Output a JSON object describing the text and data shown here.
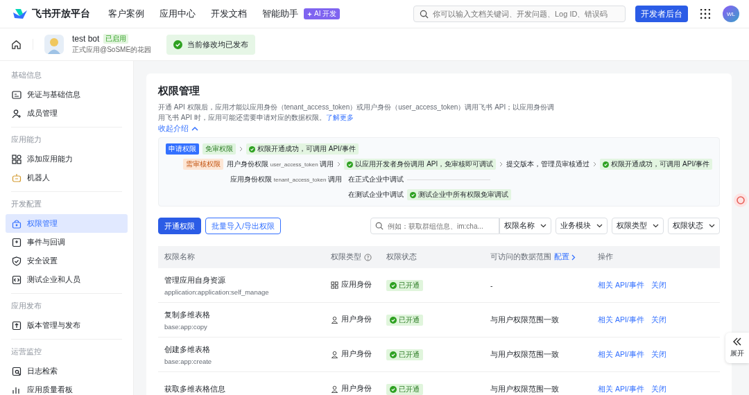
{
  "header": {
    "brand": "飞书开放平台",
    "nav": [
      {
        "label": "客户案例"
      },
      {
        "label": "应用中心"
      },
      {
        "label": "开发文档"
      },
      {
        "label": "智能助手",
        "badge": "AI 开发"
      }
    ],
    "search": {
      "placeholder": "你可以输入文档关键词、开发问题、Log ID、错误码"
    },
    "console_button": "开发者后台",
    "user_initials": "WL"
  },
  "app_bar": {
    "app_name": "test bot",
    "app_status": "已启用",
    "app_subtitle": "正式应用@SoSME的花园",
    "notice": "当前修改均已发布"
  },
  "sidebar": {
    "groups": [
      {
        "title": "基础信息",
        "items": [
          {
            "label": "凭证与基础信息",
            "selected": false
          },
          {
            "label": "成员管理",
            "selected": false
          }
        ]
      },
      {
        "title": "应用能力",
        "items": [
          {
            "label": "添加应用能力",
            "selected": false
          },
          {
            "label": "机器人",
            "selected": false
          }
        ]
      },
      {
        "title": "开发配置",
        "items": [
          {
            "label": "权限管理",
            "selected": true
          },
          {
            "label": "事件与回调",
            "selected": false
          },
          {
            "label": "安全设置",
            "selected": false
          },
          {
            "label": "测试企业和人员",
            "selected": false
          }
        ]
      },
      {
        "title": "应用发布",
        "items": [
          {
            "label": "版本管理与发布",
            "selected": false
          }
        ]
      },
      {
        "title": "运营监控",
        "items": [
          {
            "label": "日志检索",
            "selected": false
          },
          {
            "label": "应用质量看板",
            "selected": false
          }
        ]
      }
    ]
  },
  "page": {
    "title": "权限管理",
    "description": "开通 API 权限后，应用才能以应用身份（tenant_access_token）或用户身份（user_access_token）调用飞书 API；以应用身份调用飞书 API 时，应用可能还需要申请对应的数据权限。",
    "learn_more": "了解更多",
    "collapse": "收起介绍",
    "diagram": {
      "apply": "申请权限",
      "free": "免审权限",
      "free_result": "权限开通成功，可调用 API/事件",
      "review": "需审核权限",
      "user_identity": "用户身份权限",
      "user_token": "user_access_token",
      "user_call": "调用",
      "user_debug": "以应用开发者身份调用 API，免审核即可调试",
      "submit": "提交版本，管理员审核通过",
      "review_result": "权限开通成功，可调用 API/事件",
      "app_identity": "应用身份权限",
      "app_token": "tenant_access_token",
      "app_call": "调用",
      "formal_debug": "在正式企业中调试",
      "test_debug": "在测试企业中调试",
      "test_result": "测试企业中所有权限免审调试"
    },
    "actions": [
      {
        "label": "开通权限",
        "kind": "primary"
      },
      {
        "label": "批量导入/导出权限",
        "kind": "outline"
      }
    ],
    "filter": {
      "placeholder": "例如：获取群组信息、im:cha...",
      "field": "权限名称",
      "dropdowns": [
        "业务模块",
        "权限类型",
        "权限状态"
      ]
    },
    "table": {
      "columns": [
        {
          "label": "权限名称"
        },
        {
          "label": "权限类型",
          "help": true
        },
        {
          "label": "权限状态"
        },
        {
          "label": "可访问的数据范围",
          "link": "配置"
        },
        {
          "label": "操作"
        }
      ],
      "rows": [
        {
          "name": "管理应用自身资源",
          "scope": "application:application:self_manage",
          "type": {
            "kind": "app",
            "label": "应用身份"
          },
          "status": "已开通",
          "range": "-",
          "links": [
            "相关 API/事件",
            "关闭"
          ]
        },
        {
          "name": "复制多维表格",
          "scope": "base:app:copy",
          "type": {
            "kind": "user",
            "label": "用户身份"
          },
          "status": "已开通",
          "range": "与用户权限范围一致",
          "links": [
            "相关 API/事件",
            "关闭"
          ]
        },
        {
          "name": "创建多维表格",
          "scope": "base:app:create",
          "type": {
            "kind": "user",
            "label": "用户身份"
          },
          "status": "已开通",
          "range": "与用户权限范围一致",
          "links": [
            "相关 API/事件",
            "关闭"
          ]
        },
        {
          "name": "获取多维表格信息",
          "type": {
            "kind": "user",
            "label": "用户身份"
          },
          "status": "已开通",
          "range": "与用户权限范围一致",
          "links": [
            "相关 API/事件",
            "关闭"
          ]
        }
      ]
    }
  },
  "expand_panel": "展开"
}
